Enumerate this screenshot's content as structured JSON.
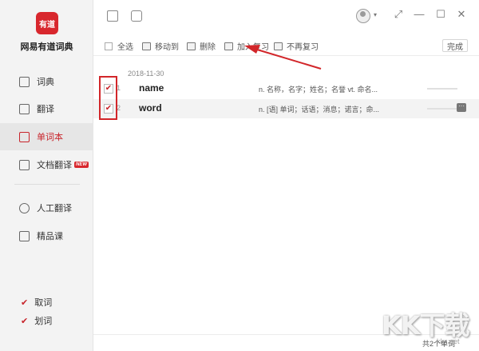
{
  "app": {
    "logo_text": "有道",
    "name": "网易有道词典"
  },
  "sidebar": {
    "items": [
      {
        "label": "词典",
        "icon": "dictionary-icon"
      },
      {
        "label": "翻译",
        "icon": "translate-icon"
      },
      {
        "label": "单词本",
        "icon": "wordbook-icon",
        "active": true
      },
      {
        "label": "文档翻译",
        "icon": "document-icon",
        "badge": "NEW"
      },
      {
        "label": "人工翻译",
        "icon": "headset-icon"
      },
      {
        "label": "精品课",
        "icon": "course-icon"
      }
    ],
    "options": [
      {
        "label": "取词",
        "checked": true
      },
      {
        "label": "划词",
        "checked": true
      }
    ]
  },
  "toolbar": {
    "select_all": "全选",
    "move_to": "移动到",
    "delete": "删除",
    "add_review": "加入复习",
    "no_review": "不再复习",
    "done": "完成"
  },
  "list": {
    "date": "2018-11-30",
    "rows": [
      {
        "index": "1",
        "word": "name",
        "definition": "n. 名称，名字；姓名；名誉  vt. 命名...",
        "checked": true
      },
      {
        "index": "2",
        "word": "word",
        "definition": "n. [语] 单词；话语；消息；诺言；命...",
        "checked": true
      }
    ]
  },
  "footer": {
    "count": "共2个单词"
  },
  "watermark": {
    "text": "KK下载",
    "url": "kkx.net"
  },
  "colors": {
    "accent": "#d8272d",
    "annotation": "#d2262a"
  }
}
